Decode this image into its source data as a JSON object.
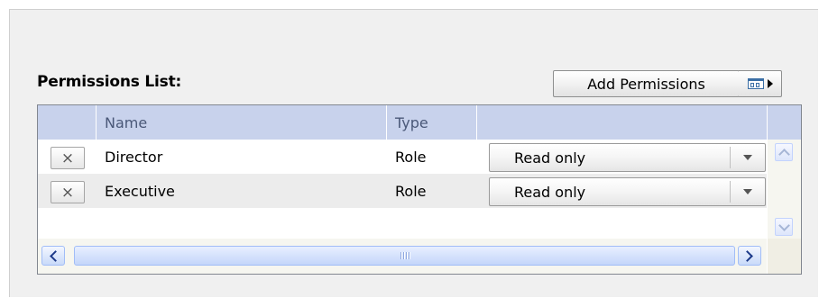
{
  "section": {
    "title": "Permissions List:"
  },
  "toolbar": {
    "add_label": "Add Permissions",
    "columns_icon": "columns-icon",
    "menu_icon": "triangle-right-icon"
  },
  "grid": {
    "headers": [
      "",
      "Name",
      "Type",
      ""
    ],
    "rows": [
      {
        "delete_glyph": "×",
        "name": "Director",
        "type": "Role",
        "access": "Read only"
      },
      {
        "delete_glyph": "×",
        "name": "Executive",
        "type": "Role",
        "access": "Read only"
      }
    ],
    "header_color": "#c8d2ec"
  }
}
